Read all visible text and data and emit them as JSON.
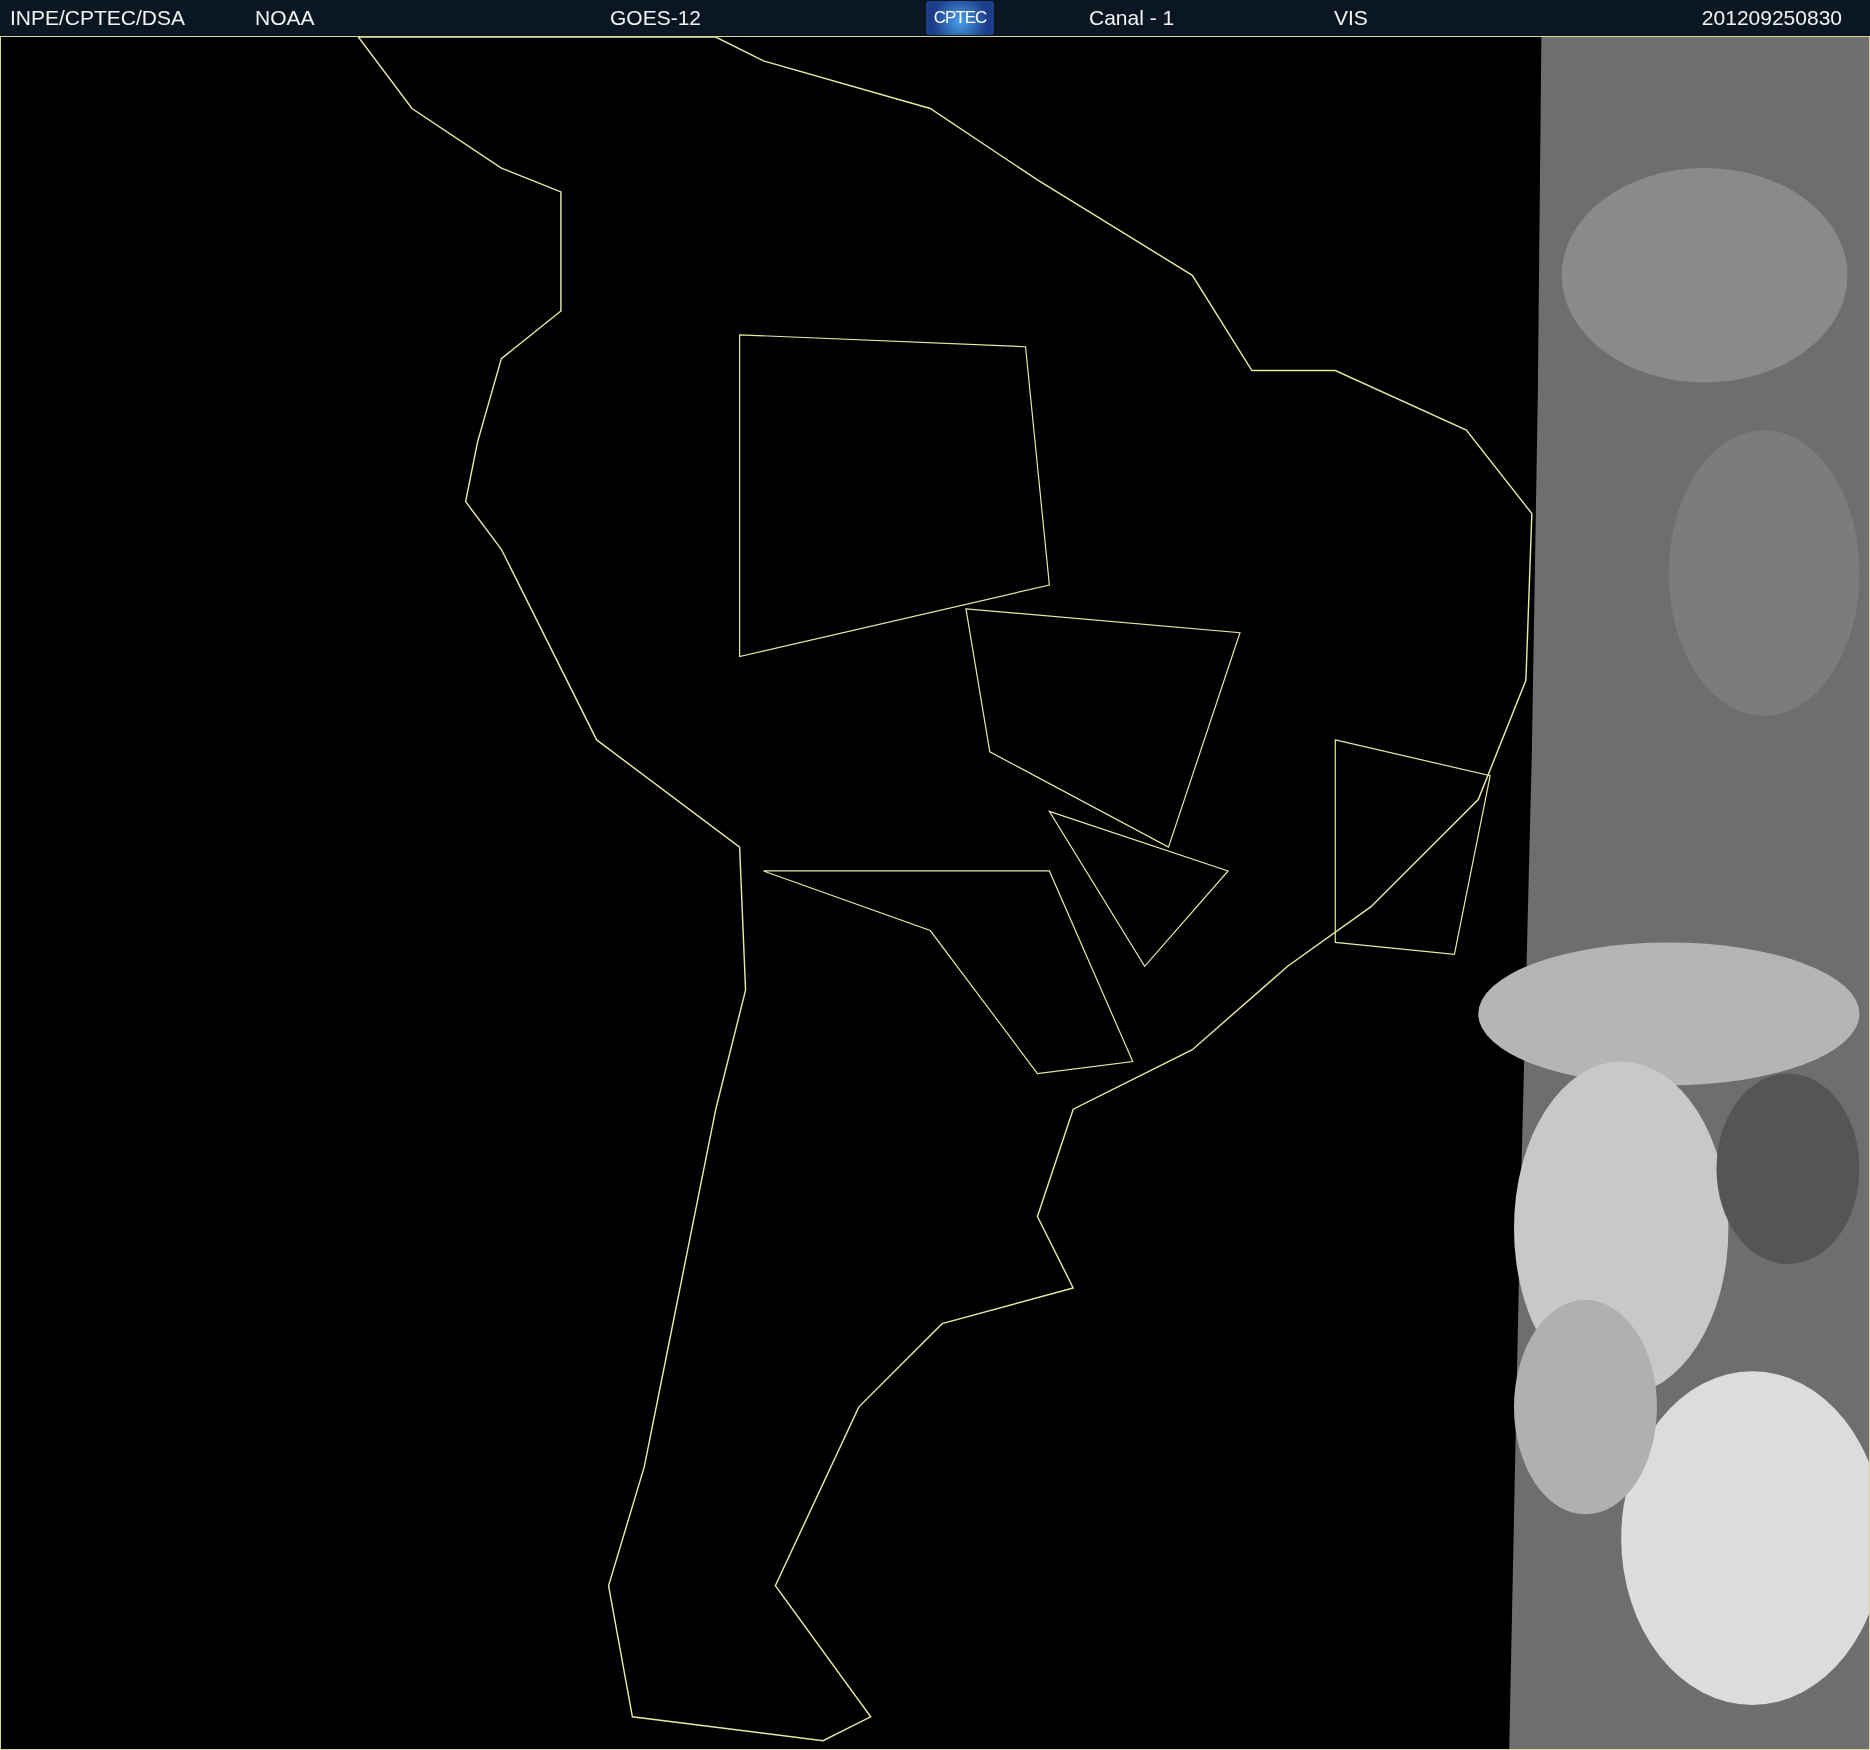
{
  "header": {
    "items": [
      {
        "kind": "text",
        "label": "INPE/CPTEC/DSA"
      },
      {
        "kind": "text",
        "label": "NOAA"
      },
      {
        "kind": "text",
        "label": "GOES-12"
      },
      {
        "kind": "logo",
        "label": "CPTEC"
      },
      {
        "kind": "text",
        "label": "Canal - 1"
      },
      {
        "kind": "text",
        "label": "VIS"
      },
      {
        "kind": "text",
        "label": "201209250830"
      }
    ]
  }
}
